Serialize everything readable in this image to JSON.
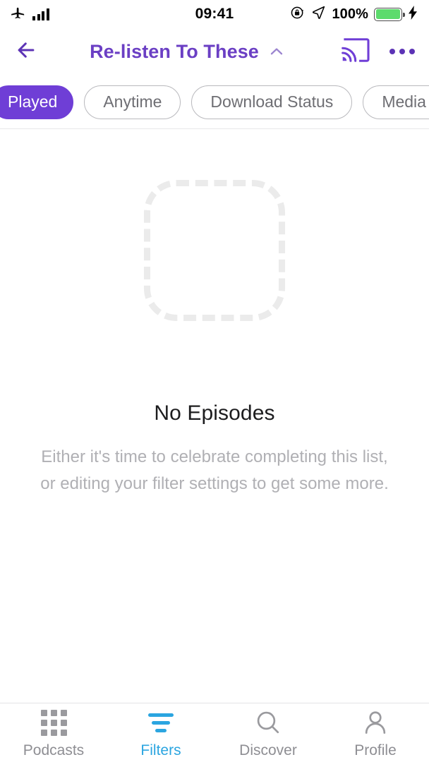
{
  "status_bar": {
    "airplane_icon": "airplane-icon",
    "signal_icon": "signal-bars-icon",
    "time": "09:41",
    "rotation_lock_icon": "rotation-lock-icon",
    "location_icon": "location-arrow-icon",
    "battery_percent": "100%",
    "battery_icon": "battery-icon",
    "charging_icon": "lightning-bolt-icon"
  },
  "nav": {
    "back_icon": "back-arrow-icon",
    "title": "Re-listen To These",
    "chevron_icon": "chevron-up-icon",
    "cast_icon": "chromecast-icon",
    "overflow_icon": "more-options-icon"
  },
  "filters": {
    "chips": [
      {
        "label": "Played",
        "active": true
      },
      {
        "label": "Anytime",
        "active": false
      },
      {
        "label": "Download Status",
        "active": false
      },
      {
        "label": "Media Type",
        "active": false
      }
    ]
  },
  "empty_state": {
    "placeholder_icon": "dashed-square-placeholder-icon",
    "title": "No Episodes",
    "subtitle_line1": "Either it's time to celebrate completing this list,",
    "subtitle_line2": "or editing your filter settings to get some more."
  },
  "tab_bar": {
    "tabs": [
      {
        "label": "Podcasts",
        "icon": "grid-icon",
        "active": false
      },
      {
        "label": "Filters",
        "icon": "filter-icon",
        "active": true
      },
      {
        "label": "Discover",
        "icon": "search-icon",
        "active": false
      },
      {
        "label": "Profile",
        "icon": "person-icon",
        "active": false
      }
    ]
  },
  "colors": {
    "brand_purple": "#6b3fc4",
    "chip_active_purple": "#6f3ed6",
    "accent_blue": "#2ba5e0",
    "battery_green": "#5ddb6d",
    "muted_gray": "#b0b0b4"
  }
}
